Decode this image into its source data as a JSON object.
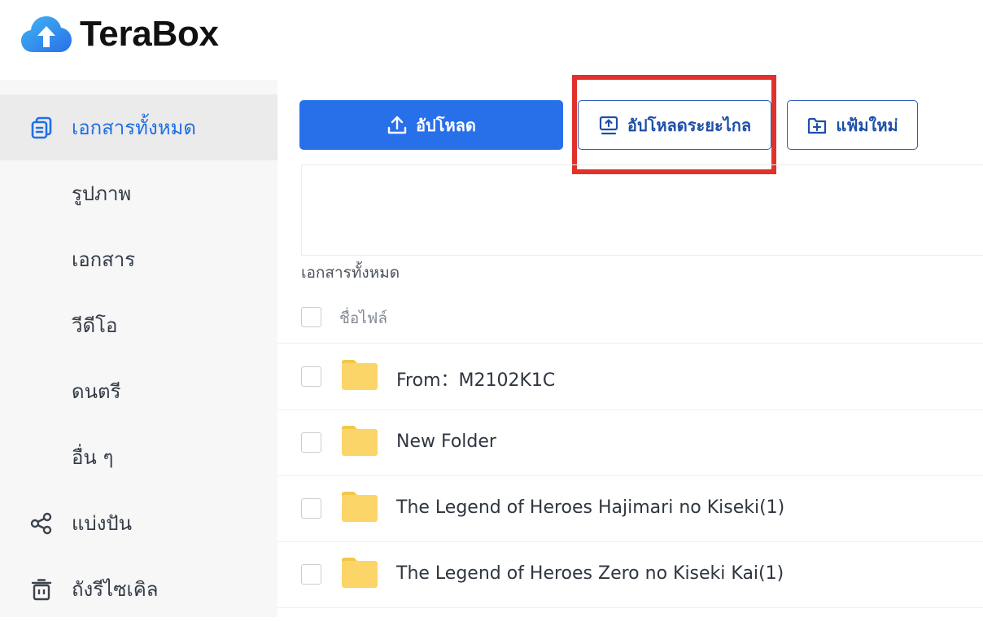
{
  "header": {
    "logo_text": "TeraBox"
  },
  "sidebar": {
    "items": [
      {
        "label": "เอกสารทั้งหมด",
        "icon": "all-files-icon",
        "active": true
      },
      {
        "label": "รูปภาพ"
      },
      {
        "label": "เอกสาร"
      },
      {
        "label": "วีดีโอ"
      },
      {
        "label": "ดนตรี"
      },
      {
        "label": "อื่น ๆ"
      },
      {
        "label": "แบ่งปัน",
        "icon": "share-icon"
      },
      {
        "label": "ถังรีไซเคิล",
        "icon": "trash-icon"
      }
    ]
  },
  "toolbar": {
    "upload_label": "อัปโหลด",
    "remote_upload_label": "อัปโหลดระยะไกล",
    "new_folder_label": "แฟ้มใหม่"
  },
  "main": {
    "section_title": "เอกสารทั้งหมด",
    "column_name": "ชื่อไฟล์",
    "files": [
      {
        "name": "From：M2102K1C",
        "type": "folder"
      },
      {
        "name": "New Folder",
        "type": "folder"
      },
      {
        "name": "The Legend of Heroes Hajimari no Kiseki(1)",
        "type": "folder"
      },
      {
        "name": "The Legend of Heroes Zero no Kiseki Kai(1)",
        "type": "folder"
      }
    ]
  },
  "colors": {
    "accent": "#2870ea",
    "active_text": "#1f6fe5",
    "highlight": "#e0322b",
    "folder": "#fbd567"
  }
}
